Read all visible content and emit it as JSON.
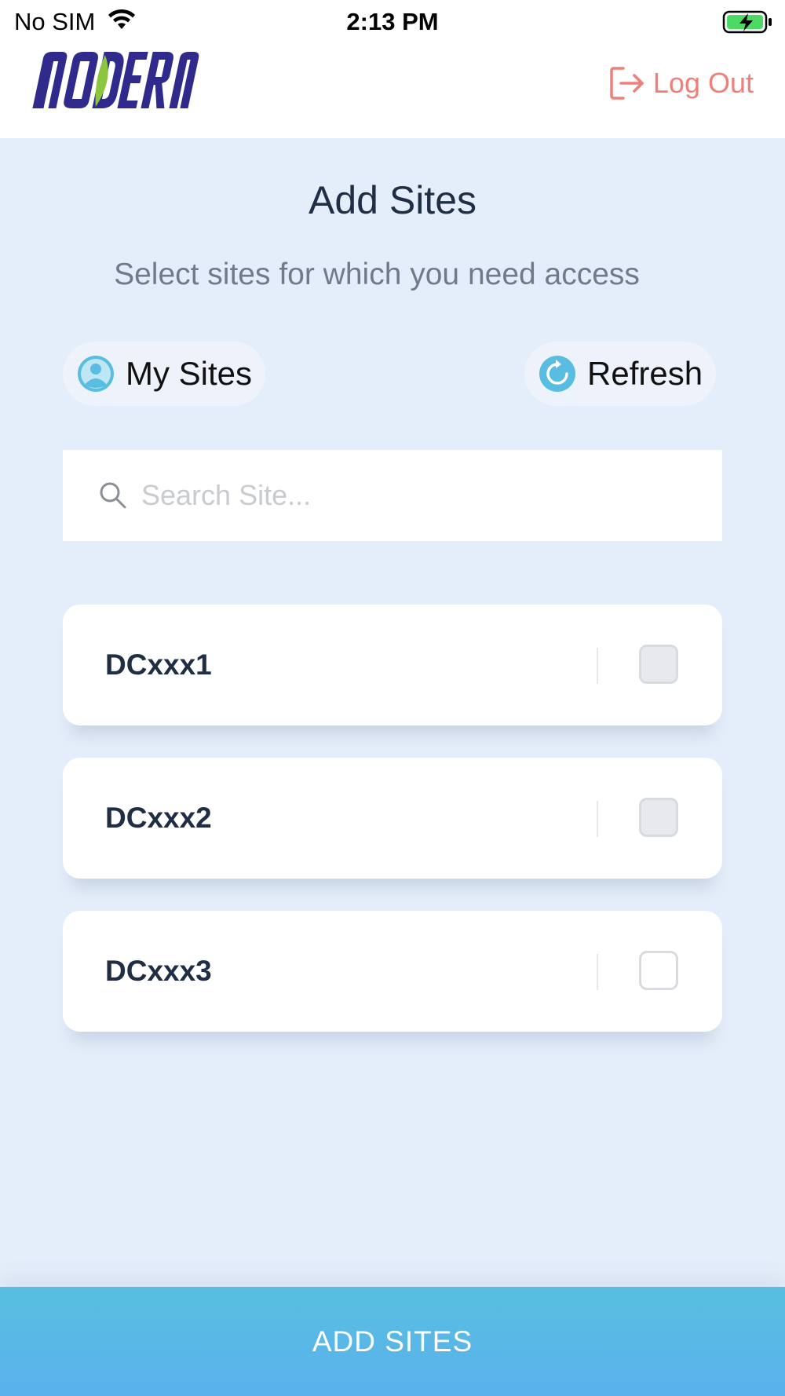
{
  "status_bar": {
    "carrier": "No SIM",
    "time": "2:13 PM"
  },
  "header": {
    "logo_text": "MODERN",
    "logout_label": "Log Out"
  },
  "page": {
    "title": "Add Sites",
    "subtitle": "Select sites for which you need access"
  },
  "actions": {
    "my_sites_label": "My Sites",
    "refresh_label": "Refresh"
  },
  "search": {
    "placeholder": "Search Site...",
    "value": ""
  },
  "sites": [
    {
      "name": "DCxxx1",
      "checked": false
    },
    {
      "name": "DCxxx2",
      "checked": false
    },
    {
      "name": "DCxxx3",
      "checked": false
    }
  ],
  "footer": {
    "add_button_label": "ADD SITES"
  },
  "colors": {
    "background": "#e4eefa",
    "logout": "#ef7f78",
    "accent_blue": "#5ab1ec",
    "logo_blue": "#2f2a8c",
    "logo_green": "#8cc63f"
  }
}
